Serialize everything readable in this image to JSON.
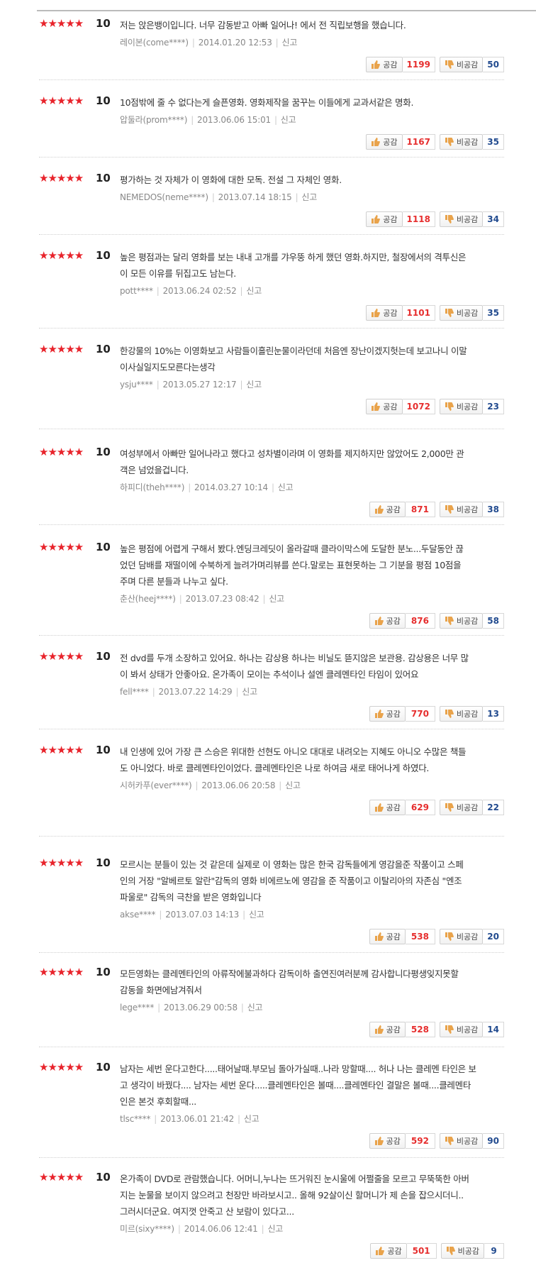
{
  "labels": {
    "agree": "공감",
    "disagree": "비공감",
    "report": "신고",
    "stars": "★★★★★"
  },
  "reviews": [
    {
      "score": "10",
      "text": "저는 앉은뱅이입니다. 너무 감동받고 아빠 일어나! 에서 전 직립보행을 했습니다.",
      "user": "레이본(come****)",
      "date": "2014.01.20 12:53",
      "agree": "1199",
      "disagree": "50"
    },
    {
      "score": "10",
      "text": "10점밖에 줄 수 없다는게 슬픈영화. 영화제작을 꿈꾸는 이들에게 교과서같은 명화.",
      "user": "압둘라(prom****)",
      "date": "2013.06.06 15:01",
      "agree": "1167",
      "disagree": "35"
    },
    {
      "score": "10",
      "text": "평가하는 것 자체가 이 영화에 대한 모독. 전설 그 자체인 영화.",
      "user": "NEMEDOS(neme****)",
      "date": "2013.07.14 18:15",
      "agree": "1118",
      "disagree": "34"
    },
    {
      "score": "10",
      "text": "높은 평점과는 달리 영화를 보는 내내 고개를 갸우뚱 하게 했던 영화.하지만, 철장에서의 격투신은\n이 모든 이유를 뒤집고도 남는다.",
      "user": "pott****",
      "date": "2013.06.24 02:52",
      "agree": "1101",
      "disagree": "35"
    },
    {
      "score": "10",
      "text": "한강물의 10%는 이영화보고 사람들이흘린눈물이라던데 처음엔 장난이겠지헛는데 보고나니 이말\n이사실일지도모른다는생각",
      "user": "ysju****",
      "date": "2013.05.27 12:17",
      "agree": "1072",
      "disagree": "23"
    },
    {
      "score": "10",
      "text": "여성부에서 아빠만 일어나라고 했다고 성차별이라며 이 영화를 제지하지만 않았어도 2,000만 관\n객은 넘었을겁니다.",
      "user": "하피디(theh****)",
      "date": "2014.03.27 10:14",
      "agree": "871",
      "disagree": "38"
    },
    {
      "score": "10",
      "text": "높은 평점에 어렵게 구해서 봤다.엔딩크레딧이 올라갈때 클라이막스에 도달한 분노...두달동안 끊\n었던 담배를 재떨이에 수북하게 늘려가며리뷰를 쓴다.말로는 표현못하는 그 기분을 평점 10점을\n주며 다른 분들과 나누고 싶다.",
      "user": "춘산(heej****)",
      "date": "2013.07.23 08:42",
      "agree": "876",
      "disagree": "58"
    },
    {
      "score": "10",
      "text": "전 dvd를 두개 소장하고 있어요. 하나는 감상용 하나는 비닐도 뜯지않은 보관용. 감상용은 너무 많\n이 봐서 상태가 안좋아요. 온가족이 모이는 추석이나 설엔 클레멘타인 타임이 있어요",
      "user": "fell****",
      "date": "2013.07.22 14:29",
      "agree": "770",
      "disagree": "13"
    },
    {
      "score": "10",
      "text": "내 인생에 있어 가장 큰 스승은 위대한 선현도 아니오 대대로 내려오는 지혜도 아니오 수많은 책들\n도 아니었다. 바로 클레멘타인이었다. 클레멘타인은 나로 하여금 새로 태어나게 하였다.",
      "user": "시허카푸(ever****)",
      "date": "2013.06.06 20:58",
      "agree": "629",
      "disagree": "22"
    },
    {
      "score": "10",
      "text": "모르시는 분들이 있는 것 같은데 실제로 이 영화는 많은 한국 감독들에게 영감을준 작품이고 스페\n인의 거장 \"알베르토 알란\"감독의 영화 비에르노에 영감을 준 작품이고 이탈리아의 자존심 \"엔조\n파울로\" 감독의 극찬을 받은 영화입니다",
      "user": "akse****",
      "date": "2013.07.03 14:13",
      "agree": "538",
      "disagree": "20"
    },
    {
      "score": "10",
      "text": "모든영화는 클레멘타인의 아류작에불과하다 감독이하 출연진여러분께 감사합니다평생잊지못할\n감동을 화면에남겨줘서",
      "user": "lege****",
      "date": "2013.06.29 00:58",
      "agree": "528",
      "disagree": "14"
    },
    {
      "score": "10",
      "text": "남자는 세번 운다고한다.....태어날때.부모님 돌아가실때..나라 망할때.... 허나 나는 클레멘 타인은 보\n고 생각이 바꿨다.... 남자는 세번 운다.....클레멘타인은 볼때....클레멘타인 결말은 볼때....클레멘타\n인은 본것 후회할때...",
      "user": "tlsc****",
      "date": "2013.06.01 21:42",
      "agree": "592",
      "disagree": "90"
    },
    {
      "score": "10",
      "text": "온가족이 DVD로 관람했습니다. 어머니,누나는 뜨거워진 눈시울에 어쩔줄을 모르고 무뚝뚝한 아버\n지는 눈물을 보이지 않으려고 천장만 바라보시고.. 올해 92살이신 할머니가 제 손을 잡으시더니..\n그러시더군요. 여지껏 안죽고 산 보람이 있다고...",
      "user": "미르(sixy****)",
      "date": "2014.06.06 12:41",
      "agree": "501",
      "disagree": "9"
    }
  ]
}
